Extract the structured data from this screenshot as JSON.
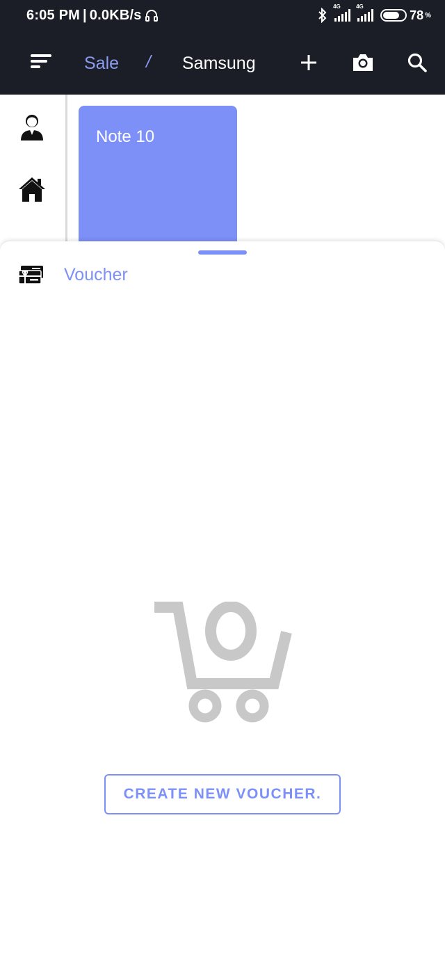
{
  "status_bar": {
    "time": "6:05 PM",
    "speed": "0.0KB/s",
    "network_1": "4G",
    "network_2": "4G",
    "battery": "78",
    "battery_unit": "%",
    "battery_level": 0.78
  },
  "header": {
    "crumb_sale": "Sale",
    "separator": "/",
    "crumb_brand": "Samsung",
    "icons": [
      "menu-icon",
      "add-icon",
      "camera-icon",
      "search-icon"
    ]
  },
  "sidebar": {
    "items": [
      "user-icon",
      "home-icon"
    ]
  },
  "products": [
    {
      "name": "Note 10"
    }
  ],
  "sheet": {
    "section_label": "Voucher",
    "empty_icon": "cart-zero-icon",
    "create_button": "CREATE NEW VOUCHER."
  },
  "colors": {
    "bar_bg": "#1b1e26",
    "accent": "#7d90f7",
    "muted_icon": "#c8c8c8"
  }
}
